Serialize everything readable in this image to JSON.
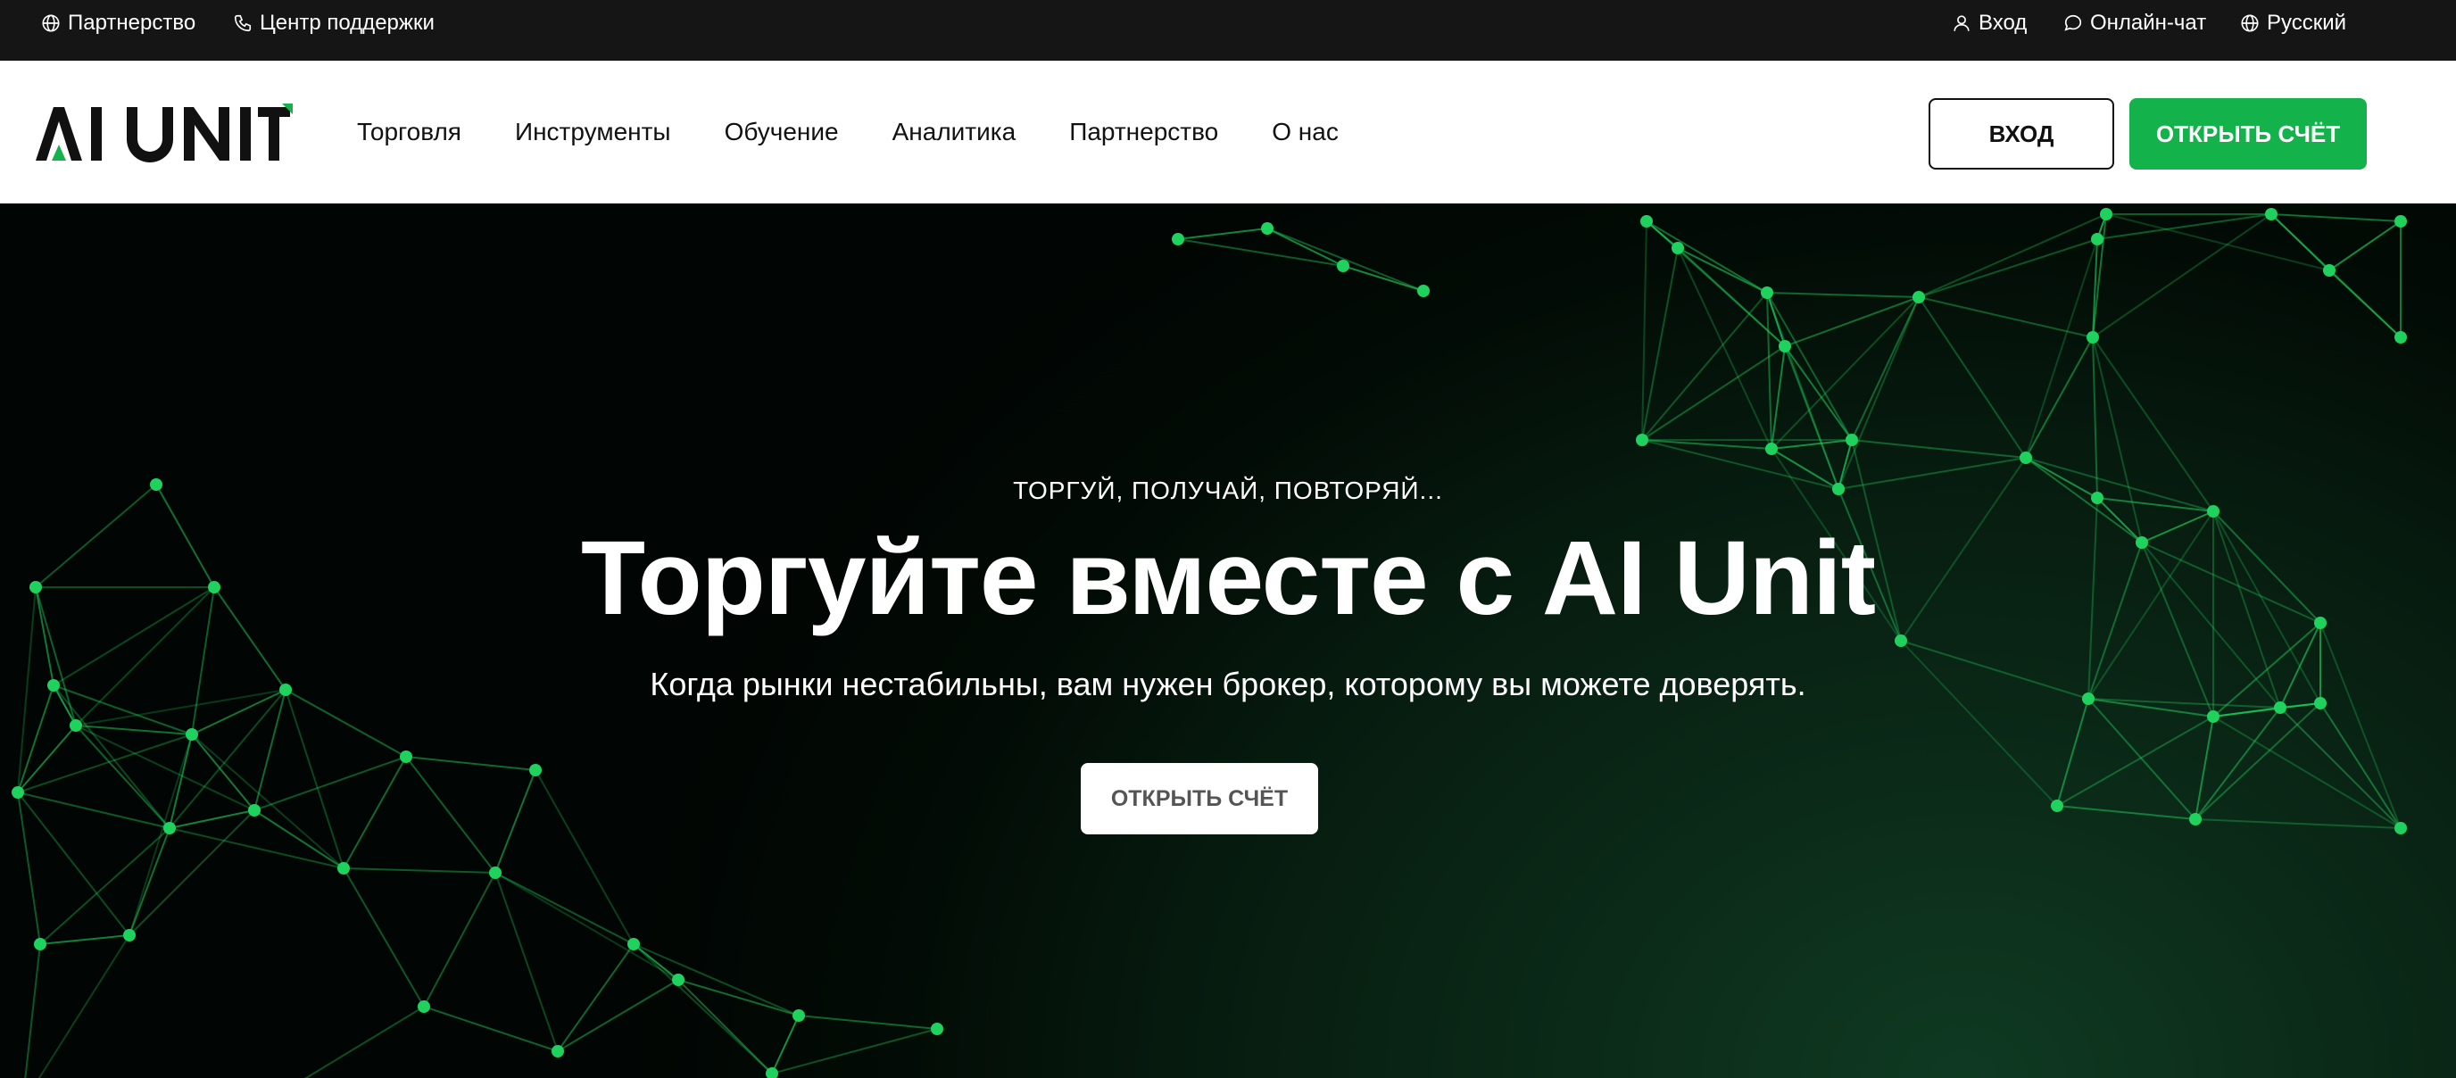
{
  "topbar": {
    "partnership": {
      "label": "Партнерство",
      "icon": "globe-icon"
    },
    "support": {
      "label": "Центр поддержки",
      "icon": "phone-icon"
    },
    "login": {
      "label": "Вход",
      "icon": "user-icon"
    },
    "chat": {
      "label": "Онлайн-чат",
      "icon": "chat-bubble-icon"
    },
    "language": {
      "label": "Русский",
      "icon": "globe-icon"
    }
  },
  "header": {
    "logo_text": "AI UNIT",
    "nav": [
      "Торговля",
      "Инструменты",
      "Обучение",
      "Аналитика",
      "Партнерство",
      "О нас"
    ],
    "login_button": "ВХОД",
    "open_account_button": "ОТКРЫТЬ СЧЁТ"
  },
  "hero": {
    "tagline": "ТОРГУЙ, ПОЛУЧАЙ, ПОВТОРЯЙ...",
    "title": "Торгуйте вместе с AI Unit",
    "subtitle": "Когда рынки нестабильны, вам нужен брокер, которому вы можете доверять.",
    "cta": "ОТКРЫТЬ СЧЁТ"
  },
  "colors": {
    "accent_green": "#13b24a",
    "network_green": "#1fd25e",
    "topbar_bg": "#151515",
    "header_bg": "#ffffff"
  }
}
